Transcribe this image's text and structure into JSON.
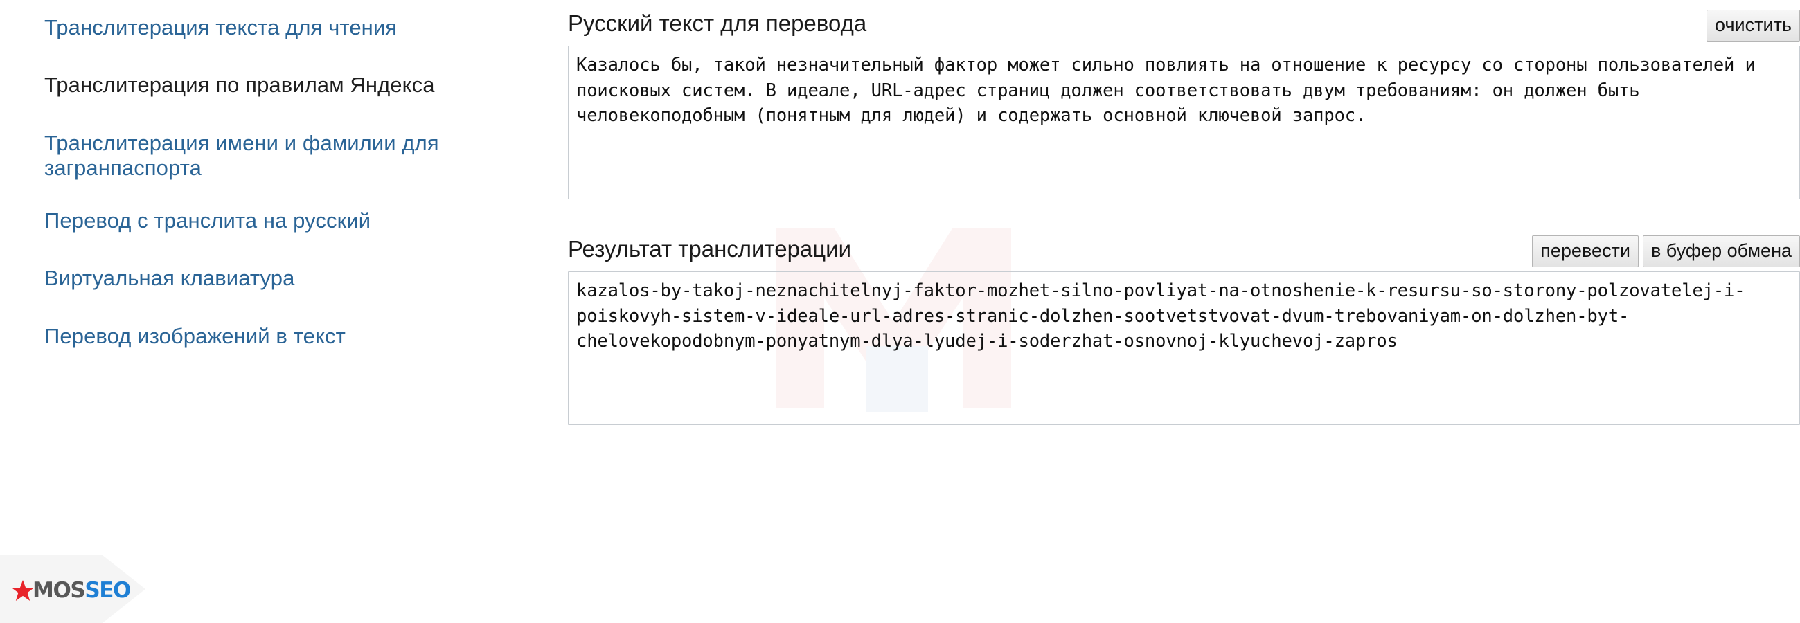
{
  "sidebar": {
    "items": [
      {
        "label": "Транслитерация текста для чтения",
        "style": "link"
      },
      {
        "label": "Транслитерация по правилам Яндекса",
        "style": "plain"
      },
      {
        "label": "Транслитерация имени и фамилии для загранпаспорта",
        "style": "link"
      },
      {
        "label": "Перевод с транслита на русский",
        "style": "link"
      },
      {
        "label": "Виртуальная клавиатура",
        "style": "link"
      },
      {
        "label": "Перевод изображений в текст",
        "style": "link"
      }
    ]
  },
  "source": {
    "title": "Русский текст для перевода",
    "clear_label": "очистить",
    "value": "Казалось бы, такой незначительный фактор может сильно повлиять на отношение к ресурсу со стороны пользователей и поисковых систем. В идеале, URL-адрес страниц должен соответствовать двум требованиям: он должен быть человекоподобным (понятным для людей) и содержать основной ключевой запрос.",
    "placeholder": ""
  },
  "result": {
    "title": "Результат транслитерации",
    "translate_label": "перевести",
    "clipboard_label": "в буфер обмена",
    "value": "kazalos-by-takoj-neznachitelnyj-faktor-mozhet-silno-povliyat-na-otnoshenie-k-resursu-so-storony-polzovatelej-i-poiskovyh-sistem-v-ideale-url-adres-stranic-dolzhen-sootvetstvovat-dvum-trebovaniyam-on-dolzhen-byt-chelovekopodobnym-ponyatnym-dlya-lyudej-i-soderzhat-osnovnoj-klyuchevoj-zapros",
    "placeholder": ""
  },
  "logo": {
    "text_primary": "MOS",
    "text_secondary": "SEO",
    "icon": "star-icon",
    "colors": {
      "star": "#e8232a",
      "primary": "#585858",
      "secondary": "#1f7fd4"
    }
  },
  "colors": {
    "link": "#2a6496",
    "text": "#1a1a1a",
    "border": "#c8cdd2",
    "button_bg": "#ececec"
  }
}
